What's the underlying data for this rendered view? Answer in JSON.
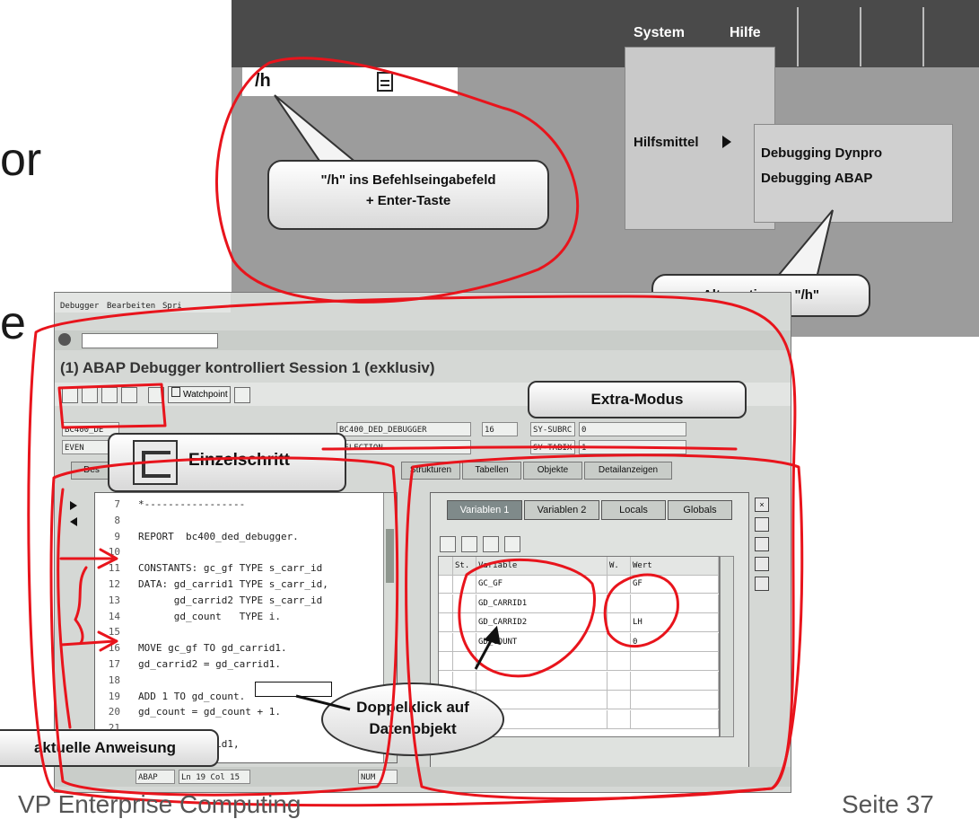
{
  "slide": {
    "fragment_top": "or",
    "fragment_mid": "e",
    "footer_left": "VP Enterprise Computing",
    "footer_right": "Seite 37"
  },
  "menu_screenshot": {
    "menu_system": "System",
    "menu_hilfe": "Hilfe",
    "command_value": "/h",
    "hilfsmittel": "Hilfsmittel",
    "submenu": [
      "Debugging  Dynpro",
      "Debugging ABAP"
    ],
    "bubble_h_line1": "\"/h\"  ins Befehlseingabefeld",
    "bubble_h_line2": "+  Enter-Taste",
    "bubble_alt": "Alternative zu \"/h\""
  },
  "debugger": {
    "menu": [
      "Debugger",
      "Bearbeiten",
      "Spri"
    ],
    "title": "(1)  ABAP Debugger kontrolliert Session 1 (exklusiv)",
    "watchpoint_label": "Watchpoint",
    "fields": {
      "prog": "BC400_DE",
      "prog2": "BC400_DED_DEBUGGER",
      "line": "16",
      "event": "EVEN",
      "event2": "SELECTION",
      "sysubrc_label": "SY-SUBRC",
      "sysubrc_value": "0",
      "sytabix_label": "SY-TABIX",
      "sytabix_value": "1"
    },
    "tabs": [
      "Des",
      "Strukturen",
      "Tabellen",
      "Objekte",
      "Detailanzeigen"
    ],
    "code_lines": [
      {
        "n": "7",
        "t": "*-----------------"
      },
      {
        "n": "8",
        "t": ""
      },
      {
        "n": "9",
        "t": "REPORT  bc400_ded_debugger."
      },
      {
        "n": "10",
        "t": ""
      },
      {
        "n": "11",
        "t": "CONSTANTS: gc_gf TYPE s_carr_id"
      },
      {
        "n": "12",
        "t": "DATA: gd_carrid1 TYPE s_carr_id,"
      },
      {
        "n": "13",
        "t": "      gd_carrid2 TYPE s_carr_id"
      },
      {
        "n": "14",
        "t": "      gd_count   TYPE i."
      },
      {
        "n": "15",
        "t": ""
      },
      {
        "n": "16",
        "t": "MOVE gc_gf TO gd_carrid1."
      },
      {
        "n": "17",
        "t": "gd_carrid2 = gd_carrid1."
      },
      {
        "n": "18",
        "t": ""
      },
      {
        "n": "19",
        "t": "ADD 1 TO gd_count."
      },
      {
        "n": "20",
        "t": "gd_count = gd_count + 1."
      },
      {
        "n": "21",
        "t": ""
      },
      {
        "n": "22",
        "t": "         carrid1,"
      }
    ],
    "var_tabs": [
      "Variablen 1",
      "Variablen 2",
      "Locals",
      "Globals"
    ],
    "grid_headers": [
      "St.",
      "Variable",
      "W.",
      "Wert"
    ],
    "grid_rows": [
      {
        "var": "GC_GF",
        "val": "GF"
      },
      {
        "var": "GD_CARRID1",
        "val": ""
      },
      {
        "var": "GD_CARRID2",
        "val": "LH"
      },
      {
        "var": "GD_COUNT",
        "val": "0"
      },
      {
        "var": "",
        "val": ""
      },
      {
        "var": "",
        "val": ""
      },
      {
        "var": "",
        "val": ""
      },
      {
        "var": "",
        "val": ""
      }
    ],
    "status": {
      "abap": "ABAP",
      "pos": "Ln 19 Col 15",
      "num": "NUM"
    }
  },
  "callouts": {
    "einzelschritt": "Einzelschritt",
    "extra_modus": "Extra-Modus",
    "doppelklick_line1": "Doppelklick auf",
    "doppelklick_line2": "Datenobjekt",
    "aktuelle": "aktuelle Anweisung"
  },
  "colors": {
    "annotation": "#e8141c",
    "menubar": "#4a4a4a",
    "panel_bg": "#9c9c9c"
  }
}
